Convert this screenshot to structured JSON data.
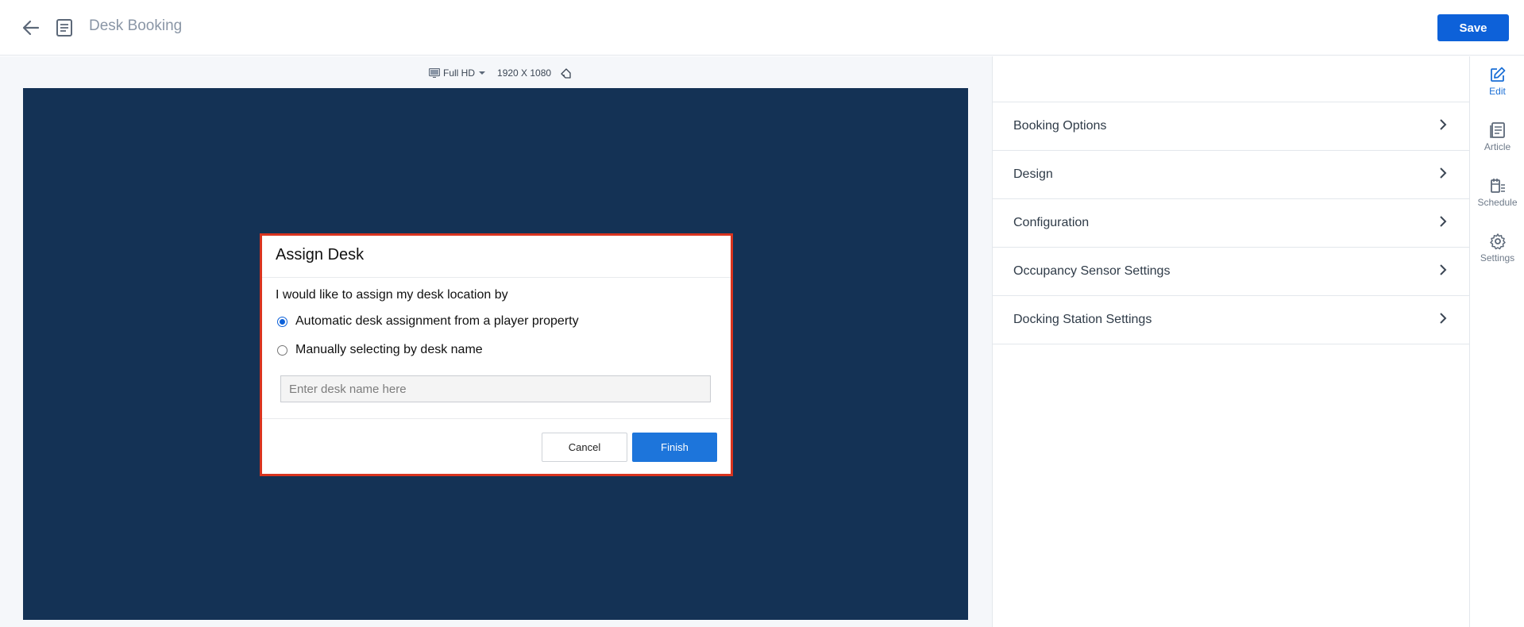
{
  "header": {
    "title": "Desk Booking",
    "save_label": "Save"
  },
  "canvas": {
    "resolution_preset": "Full HD",
    "resolution_dims": "1920 X 1080",
    "preview_background": "#143255"
  },
  "dialog": {
    "title": "Assign Desk",
    "prompt": "I would like to assign my desk location by",
    "options": [
      {
        "label": "Automatic desk assignment from a player property",
        "selected": true
      },
      {
        "label": "Manually selecting by desk name",
        "selected": false
      }
    ],
    "desk_input": {
      "value": "",
      "placeholder": "Enter desk name here"
    },
    "cancel_label": "Cancel",
    "finish_label": "Finish"
  },
  "panel": {
    "items": [
      {
        "label": "Booking Options"
      },
      {
        "label": "Design"
      },
      {
        "label": "Configuration"
      },
      {
        "label": "Occupancy Sensor Settings"
      },
      {
        "label": "Docking Station Settings"
      }
    ]
  },
  "rail": {
    "items": [
      {
        "label": "Edit",
        "icon": "edit-icon",
        "active": true
      },
      {
        "label": "Article",
        "icon": "article-icon",
        "active": false
      },
      {
        "label": "Schedule",
        "icon": "schedule-icon",
        "active": false
      },
      {
        "label": "Settings",
        "icon": "gear-icon",
        "active": false
      }
    ]
  },
  "colors": {
    "accent": "#0d61d9",
    "finish_button": "#1d75db",
    "dialog_highlight_border": "#d9341f"
  }
}
